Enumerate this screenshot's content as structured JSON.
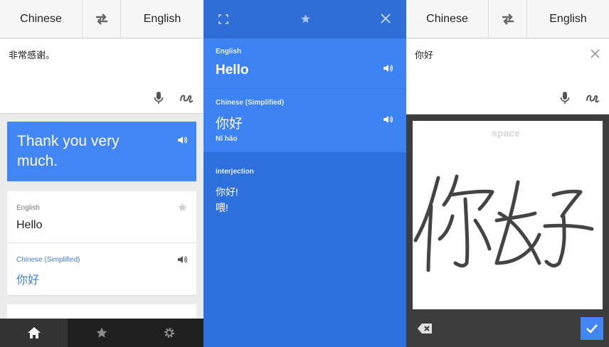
{
  "left": {
    "source_lang": "Chinese",
    "target_lang": "English",
    "input_text": "非常感谢。",
    "translation": "Thank you very much.",
    "dictionary": {
      "entry1_lang": "English",
      "entry1_word": "Hello",
      "entry2_lang": "Chinese (Simplified)",
      "entry2_word": "你好"
    },
    "nav": [
      "home-icon",
      "star-icon",
      "gear-icon"
    ]
  },
  "middle": {
    "sec1_lang": "English",
    "sec1_word": "Hello",
    "sec2_lang": "Chinese (Simplified)",
    "sec2_word": "你好",
    "sec2_pinyin": "Nǐ hǎo",
    "pos": "interjection",
    "defs": [
      "你好!",
      "喂!"
    ]
  },
  "right": {
    "source_lang": "Chinese",
    "target_lang": "English",
    "input_text": "你好",
    "space_label": "space"
  },
  "colors": {
    "accent": "#4285f4",
    "mid_dark": "#2d6fdc",
    "mid_light": "#3c82f2"
  }
}
